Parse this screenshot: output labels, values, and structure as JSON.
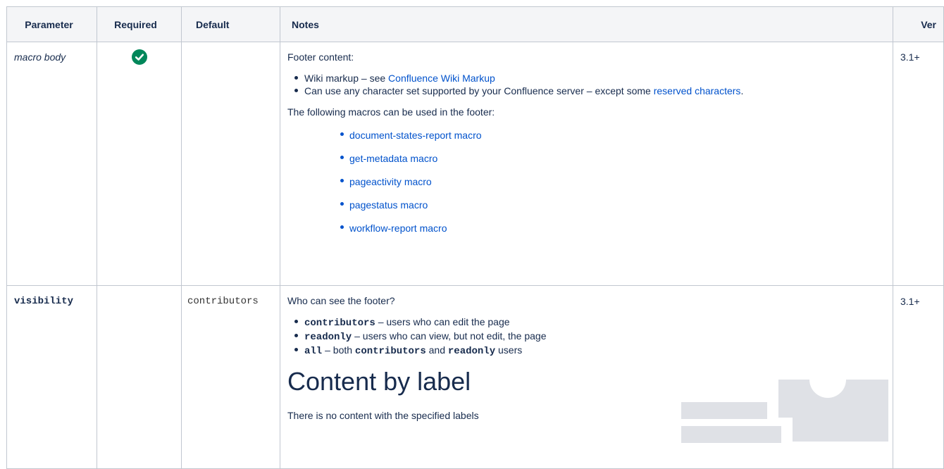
{
  "table": {
    "headers": {
      "parameter": "Parameter",
      "required": "Required",
      "default": "Default",
      "notes": "Notes",
      "ver": "Ver"
    },
    "rows": [
      {
        "parameter": "macro body",
        "required_icon": "check-circle-icon",
        "default": "",
        "ver": "3.1+",
        "notes": {
          "intro": "Footer content:",
          "bullet1_text": "Wiki markup – see ",
          "bullet1_link": "Confluence Wiki Markup",
          "bullet2_text": "Can use any character set supported by your Confluence server – except some ",
          "bullet2_link": "reserved characters",
          "bullet2_end": ".",
          "macros_intro": "The following macros can be used in the footer:",
          "macros": [
            "document-states-report macro",
            "get-metadata macro",
            "pageactivity macro",
            "pagestatus macro",
            "workflow-report macro"
          ]
        }
      },
      {
        "parameter": "visibility",
        "required_icon": "",
        "default": "contributors",
        "ver": "3.1+",
        "notes": {
          "intro": "Who can see the footer?",
          "opt1_code": "contributors",
          "opt1_text": " – users who can edit the page",
          "opt2_code": "readonly",
          "opt2_text": " – users who can view, but not edit, the page",
          "opt3_code": "all",
          "opt3_mid": " – both ",
          "opt3_code2": "contributors",
          "opt3_and": " and ",
          "opt3_code3": "readonly",
          "opt3_end": " users",
          "cbl_title": "Content by label",
          "cbl_empty": "There is no content with the specified labels"
        }
      }
    ]
  },
  "colors": {
    "header_bg": "#f4f5f7",
    "border": "#c1c7d0",
    "link": "#0052cc",
    "check": "#00875a",
    "placeholder_art": "#dfe1e6"
  }
}
